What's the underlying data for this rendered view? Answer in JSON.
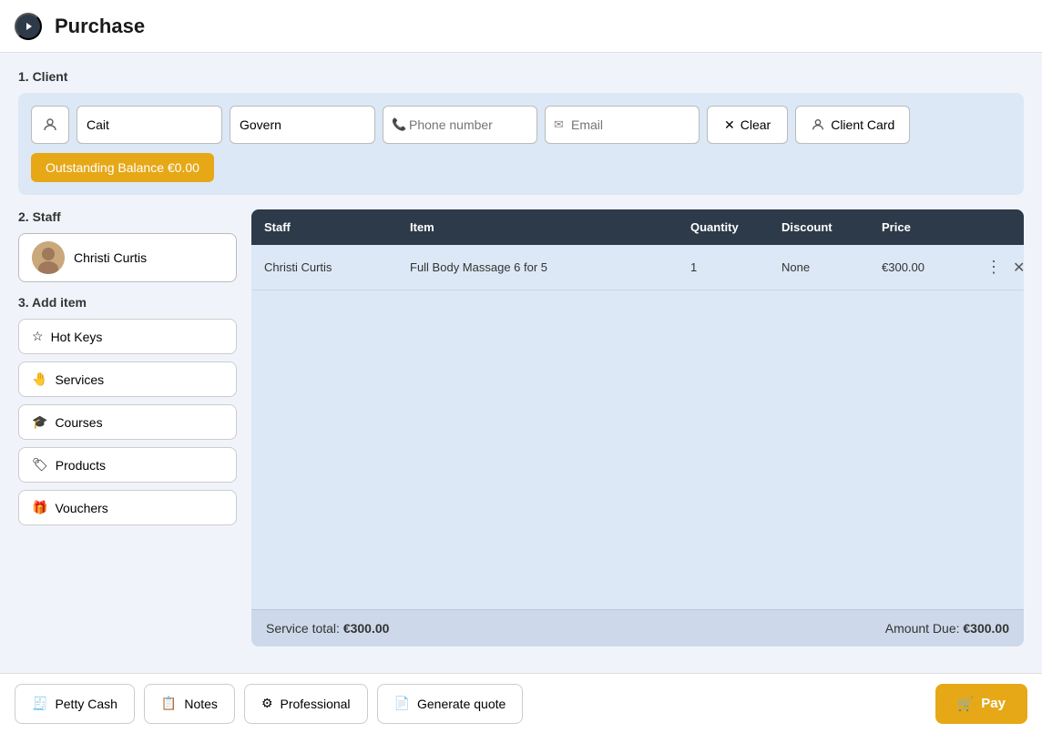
{
  "header": {
    "title": "Purchase",
    "toggle_icon": "chevron-right"
  },
  "client": {
    "section_label": "1. Client",
    "first_name": "Cait",
    "last_name": "Govern",
    "phone_placeholder": "Phone number",
    "email_placeholder": "Email",
    "clear_label": "Clear",
    "client_card_label": "Client Card",
    "outstanding_label": "Outstanding Balance €0.00"
  },
  "staff": {
    "section_label": "2. Staff",
    "name": "Christi Curtis"
  },
  "add_item": {
    "section_label": "3. Add item",
    "buttons": [
      {
        "id": "hot-keys",
        "label": "Hot Keys",
        "icon": "star"
      },
      {
        "id": "services",
        "label": "Services",
        "icon": "hand"
      },
      {
        "id": "courses",
        "label": "Courses",
        "icon": "graduation"
      },
      {
        "id": "products",
        "label": "Products",
        "icon": "tag"
      },
      {
        "id": "vouchers",
        "label": "Vouchers",
        "icon": "gift"
      }
    ]
  },
  "table": {
    "columns": [
      "Staff",
      "Item",
      "Quantity",
      "Discount",
      "Price",
      ""
    ],
    "rows": [
      {
        "staff": "Christi Curtis",
        "item": "Full Body Massage 6 for 5",
        "quantity": "1",
        "discount": "None",
        "price": "€300.00"
      }
    ],
    "service_total_label": "Service total:",
    "service_total_value": "€300.00",
    "amount_due_label": "Amount Due:",
    "amount_due_value": "€300.00"
  },
  "footer": {
    "petty_cash_label": "Petty Cash",
    "notes_label": "Notes",
    "professional_label": "Professional",
    "generate_quote_label": "Generate quote",
    "pay_label": "Pay"
  }
}
